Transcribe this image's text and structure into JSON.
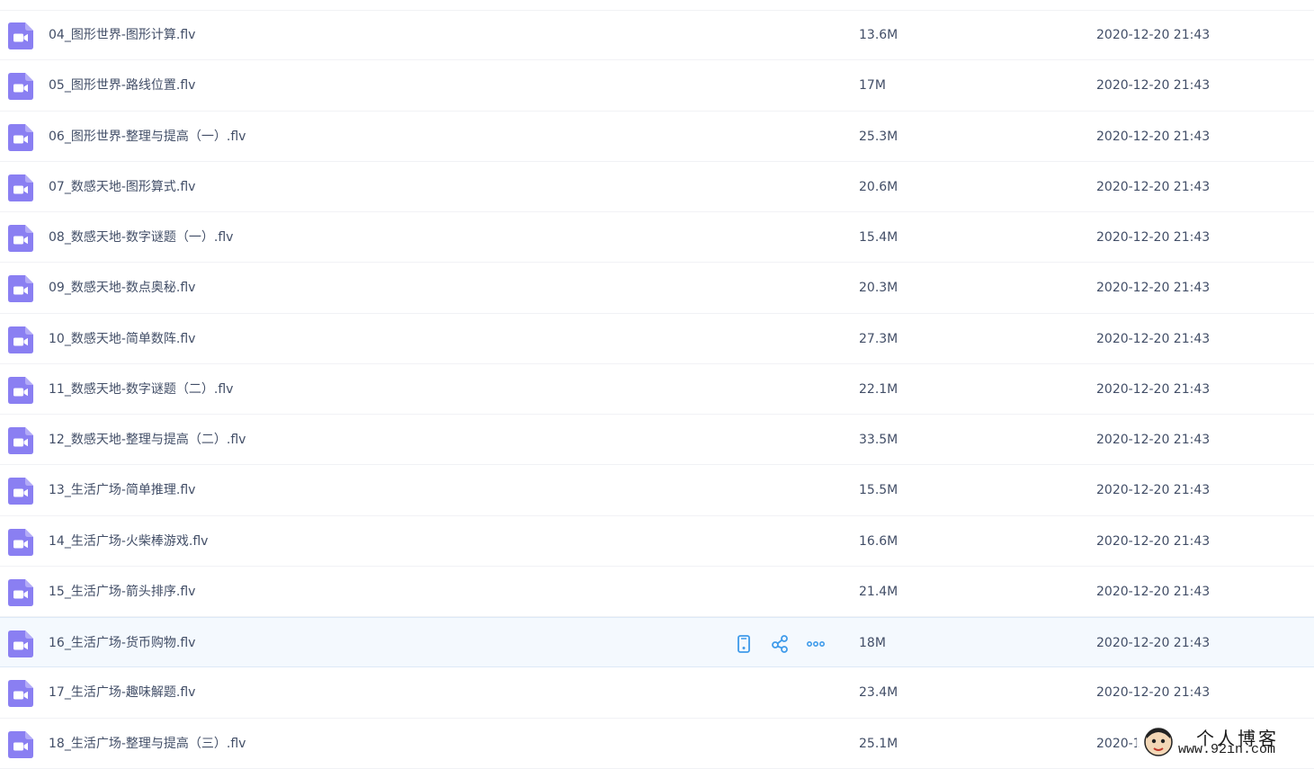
{
  "files": [
    {
      "name": "04_图形世界-图形计算.flv",
      "size": "13.6M",
      "date": "2020-12-20 21:43"
    },
    {
      "name": "05_图形世界-路线位置.flv",
      "size": "17M",
      "date": "2020-12-20 21:43"
    },
    {
      "name": "06_图形世界-整理与提高（一）.flv",
      "size": "25.3M",
      "date": "2020-12-20 21:43"
    },
    {
      "name": "07_数感天地-图形算式.flv",
      "size": "20.6M",
      "date": "2020-12-20 21:43"
    },
    {
      "name": "08_数感天地-数字谜题（一）.flv",
      "size": "15.4M",
      "date": "2020-12-20 21:43"
    },
    {
      "name": "09_数感天地-数点奥秘.flv",
      "size": "20.3M",
      "date": "2020-12-20 21:43"
    },
    {
      "name": "10_数感天地-简单数阵.flv",
      "size": "27.3M",
      "date": "2020-12-20 21:43"
    },
    {
      "name": "11_数感天地-数字谜题（二）.flv",
      "size": "22.1M",
      "date": "2020-12-20 21:43"
    },
    {
      "name": "12_数感天地-整理与提高（二）.flv",
      "size": "33.5M",
      "date": "2020-12-20 21:43"
    },
    {
      "name": "13_生活广场-简单推理.flv",
      "size": "15.5M",
      "date": "2020-12-20 21:43"
    },
    {
      "name": "14_生活广场-火柴棒游戏.flv",
      "size": "16.6M",
      "date": "2020-12-20 21:43"
    },
    {
      "name": "15_生活广场-箭头排序.flv",
      "size": "21.4M",
      "date": "2020-12-20 21:43"
    },
    {
      "name": "16_生活广场-货币购物.flv",
      "size": "18M",
      "date": "2020-12-20 21:43",
      "hovered": true
    },
    {
      "name": "17_生活广场-趣味解题.flv",
      "size": "23.4M",
      "date": "2020-12-20 21:43"
    },
    {
      "name": "18_生活广场-整理与提高（三）.flv",
      "size": "25.1M",
      "date": "2020-1"
    }
  ],
  "icons": {
    "file": "video-file-icon",
    "actions": [
      "phone-icon",
      "share-icon",
      "more-icon"
    ]
  },
  "watermark": {
    "title": "个人博客",
    "url": "www.92in.com"
  },
  "colors": {
    "icon_purple": "#8a7ff2",
    "text": "#424e67",
    "action_blue": "#3f9bea",
    "hover_row": "#f4f9fe"
  }
}
